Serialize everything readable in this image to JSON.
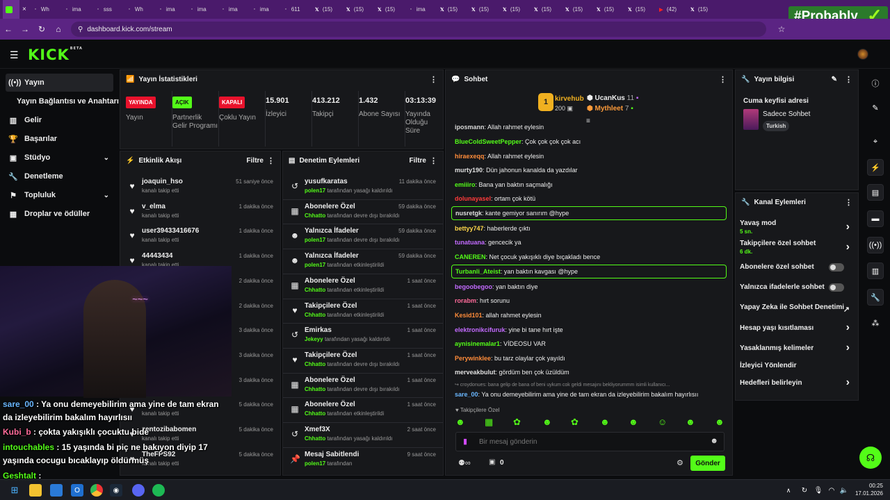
{
  "browser": {
    "tabs": [
      {
        "label": "",
        "icon": "kick-icon",
        "color": "#53fc18"
      },
      {
        "label": "Wh",
        "icon": "doc-icon",
        "color": "#bbb"
      },
      {
        "label": "ima",
        "icon": "doc-icon",
        "color": "#bbb"
      },
      {
        "label": "sss",
        "icon": "doc-icon",
        "color": "#bbb"
      },
      {
        "label": "Wh",
        "icon": "doc-icon",
        "color": "#bbb"
      },
      {
        "label": "ima",
        "icon": "doc-icon",
        "color": "#bbb"
      },
      {
        "label": "ima",
        "icon": "doc-icon",
        "color": "#bbb"
      },
      {
        "label": "ima",
        "icon": "doc-icon",
        "color": "#bbb"
      },
      {
        "label": "ima",
        "icon": "doc-icon",
        "color": "#bbb"
      },
      {
        "label": "611",
        "icon": "doc-icon",
        "color": "#bbb"
      },
      {
        "label": "(15)",
        "icon": "x-icon",
        "color": "#fff"
      },
      {
        "label": "(15)",
        "icon": "x-icon",
        "color": "#fff"
      },
      {
        "label": "(15)",
        "icon": "x-icon",
        "color": "#fff"
      },
      {
        "label": "ima",
        "icon": "doc-icon",
        "color": "#bbb"
      },
      {
        "label": "(15)",
        "icon": "x-icon",
        "color": "#fff"
      },
      {
        "label": "(15)",
        "icon": "x-icon",
        "color": "#fff"
      },
      {
        "label": "(15)",
        "icon": "x-icon",
        "color": "#fff"
      },
      {
        "label": "(15)",
        "icon": "x-icon",
        "color": "#fff"
      },
      {
        "label": "(15)",
        "icon": "x-icon",
        "color": "#fff"
      },
      {
        "label": "(15)",
        "icon": "x-icon",
        "color": "#fff"
      },
      {
        "label": "(15)",
        "icon": "x-icon",
        "color": "#fff"
      },
      {
        "label": "(42)",
        "icon": "youtube-icon",
        "color": "#ff2020"
      },
      {
        "label": "(15)",
        "icon": "x-icon",
        "color": "#fff"
      }
    ],
    "url": "dashboard.kick.com/stream",
    "overlay_tag": "#Probably"
  },
  "logo": "KICK",
  "logo_sup": "BETA",
  "sidebar": {
    "items": [
      {
        "label": "Yayın",
        "icon": "broadcast-icon"
      },
      {
        "label": "Yayın Bağlantısı ve Anahtarı",
        "icon": ""
      },
      {
        "label": "Gelir",
        "icon": "revenue-icon"
      },
      {
        "label": "Başarılar",
        "icon": "trophy-icon"
      },
      {
        "label": "Stüdyo",
        "icon": "studio-icon"
      },
      {
        "label": "Denetleme",
        "icon": "wrench-icon"
      },
      {
        "label": "Topluluk",
        "icon": "community-icon"
      },
      {
        "label": "Droplar ve ödüller",
        "icon": "gift-icon"
      }
    ]
  },
  "stats": {
    "title": "Yayın İstatistikleri",
    "items": [
      {
        "badge": "YAYINDA",
        "badge_color": "#e8122c",
        "label": "Yayın"
      },
      {
        "badge": "AÇIK",
        "badge_color": "#53fc18",
        "label": "Partnerlik Gelir Programı"
      },
      {
        "badge": "KAPALI",
        "badge_color": "#e8122c",
        "label": "Çoklu Yayın"
      },
      {
        "value": "15.901",
        "label": "İzleyici"
      },
      {
        "value": "413.212",
        "label": "Takipçi"
      },
      {
        "value": "1.432",
        "label": "Abone Sayısı"
      },
      {
        "value": "03:13:39",
        "label": "Yayında Olduğu Süre"
      }
    ]
  },
  "activity": {
    "title": "Etkinlik Akışı",
    "filter": "Filtre",
    "items": [
      {
        "name": "joaquin_hso",
        "sub": "kanalı takip etti",
        "time": "51 saniye önce"
      },
      {
        "name": "v_elma",
        "sub": "kanalı takip etti",
        "time": "1 dakika önce"
      },
      {
        "name": "user39433416676",
        "sub": "kanalı takip etti",
        "time": "1 dakika önce"
      },
      {
        "name": "44443434",
        "sub": "kanalı takip etti",
        "time": "1 dakika önce"
      },
      {
        "name": "",
        "sub": "",
        "time": "2 dakika önce"
      },
      {
        "name": "",
        "sub": "",
        "time": "2 dakika önce"
      },
      {
        "name": "",
        "sub": "",
        "time": "3 dakika önce"
      },
      {
        "name": "",
        "sub": "",
        "time": "3 dakika önce"
      },
      {
        "name": "",
        "sub": "",
        "time": "3 dakika önce"
      },
      {
        "name": "",
        "sub": "kanalı takip etti",
        "time": "5 dakika önce"
      },
      {
        "name": "zentozibabomen",
        "sub": "kanalı takip etti",
        "time": "5 dakika önce"
      },
      {
        "name": "TheFPS92",
        "sub": "kanalı takip etti",
        "time": "5 dakika önce"
      }
    ]
  },
  "moderation": {
    "title": "Denetim Eylemleri",
    "filter": "Filtre",
    "items": [
      {
        "icon": "undo-icon",
        "name": "yusufkaratas",
        "actor": "polen17",
        "sub": "tarafından yasağı kaldırıldı",
        "time": "11 dakika önce"
      },
      {
        "icon": "gift-icon",
        "name": "Abonelere Özel",
        "actor": "Chhatto",
        "sub": "tarafından devre dışı bırakıldı",
        "time": "59 dakika önce"
      },
      {
        "icon": "smile-icon",
        "name": "Yalnızca İfadeler",
        "actor": "polen17",
        "sub": "tarafından devre dışı bırakıldı",
        "time": "59 dakika önce"
      },
      {
        "icon": "smile-icon",
        "name": "Yalnızca İfadeler",
        "actor": "polen17",
        "sub": "tarafından etkinleştirildi",
        "time": "59 dakika önce"
      },
      {
        "icon": "gift-icon",
        "name": "Abonelere Özel",
        "actor": "Chhatto",
        "sub": "tarafından etkinleştirildi",
        "time": "1 saat önce"
      },
      {
        "icon": "heart-icon",
        "name": "Takipçilere Özel",
        "actor": "Chhatto",
        "sub": "tarafından etkinleştirildi",
        "time": "1 saat önce"
      },
      {
        "icon": "undo-icon",
        "name": "Emirkas",
        "actor": "Jekeyy",
        "sub": "tarafından yasağı kaldırıldı",
        "time": "1 saat önce"
      },
      {
        "icon": "heart-icon",
        "name": "Takipçilere Özel",
        "actor": "Chhatto",
        "sub": "tarafından devre dışı bırakıldı",
        "time": "1 saat önce"
      },
      {
        "icon": "gift-icon",
        "name": "Abonelere Özel",
        "actor": "Chhatto",
        "sub": "tarafından devre dışı bırakıldı",
        "time": "1 saat önce"
      },
      {
        "icon": "gift-icon",
        "name": "Abonelere Özel",
        "actor": "Chhatto",
        "sub": "tarafından etkinleştirildi",
        "time": "1 saat önce"
      },
      {
        "icon": "undo-icon",
        "name": "Xmef3X",
        "actor": "Chhatto",
        "sub": "tarafından yasağı kaldırıldı",
        "time": "2 saat önce"
      },
      {
        "icon": "pin-icon",
        "name": "Mesaj Sabitlendi",
        "actor": "polen17",
        "sub": "tarafından",
        "time": "9 saat önce"
      }
    ]
  },
  "chat": {
    "title": "Sohbet",
    "leaderboard": [
      {
        "rank": "1",
        "name": "kirvehub",
        "amount": "200"
      },
      {
        "name": "UcanKus",
        "amount": "11"
      },
      {
        "name": "Mythleet",
        "amount": "7"
      }
    ],
    "messages": [
      {
        "user": "iposmann",
        "color": "#d8d8d8",
        "text": "Allah rahmet eylesin"
      },
      {
        "user": "BlueColdSweetPepper",
        "color": "#53fc18",
        "text": "Çok çok çok çok acı"
      },
      {
        "user": "hiraexeqq",
        "color": "#ff8c3a",
        "text": "Allah rahmet eylesin"
      },
      {
        "user": "murty190",
        "color": "#e0e0e0",
        "text": "Dün jahonun kanalda da yazdılar"
      },
      {
        "user": "emiiiro",
        "color": "#53fc18",
        "text": "Bana yan baktın saçmalığı"
      },
      {
        "user": "dolunayasel",
        "color": "#ff3b3b",
        "text": "ortam çok kötü"
      },
      {
        "user": "nusretgk",
        "color": "#e0e0e0",
        "text": "kante gemiyor sanırım @hype"
      },
      {
        "user": "bettyy747",
        "color": "#ffd84a",
        "text": "haberlerde çıktı"
      },
      {
        "user": "tunatuana",
        "color": "#c36bff",
        "text": "gencecik ya"
      },
      {
        "user": "CANEREN",
        "color": "#53fc18",
        "text": "Net çocuk yakışıklı diye bıçakladı bence"
      },
      {
        "user": "Turbanli_Ateist",
        "color": "#53fc18",
        "text": "yan baktın kavgası @hype"
      },
      {
        "user": "begoobegoo",
        "color": "#c36bff",
        "text": "yan baktın diye"
      },
      {
        "user": "rorabm",
        "color": "#ff6b9a",
        "text": "hırt sorunu"
      },
      {
        "user": "Kesid101",
        "color": "#ff8c3a",
        "text": "allah rahmet eylesin"
      },
      {
        "user": "elektronikcifuruk",
        "color": "#c36bff",
        "text": "yine bi tane hırt işte"
      },
      {
        "user": "aynisinemalar1",
        "color": "#53fc18",
        "text": "VİDEOSU VAR"
      },
      {
        "user": "Perywinklee",
        "color": "#ff8c3a",
        "text": "bu tarz olaylar çok yayıldı"
      },
      {
        "user": "merveakbulut",
        "color": "#e0e0e0",
        "text": "gördüm ben çok üzüldüm"
      },
      {
        "user": "sare_00",
        "color": "#6ab7ff",
        "text": "Ya onu demeyebilirim ama yine de tam ekran da izleyebilirim bakalım hayırlısıı"
      }
    ],
    "reply_preview": "↪ croydonues: bana gelip de bana of beni uykum cok geldi mesajını bekliyorummm isimli kullanıcı...",
    "followers_only": "Takipçilere Özel",
    "input_placeholder": "Bir mesaj gönderin",
    "points": "0",
    "send": "Gönder"
  },
  "stream_info": {
    "title": "Yayın bilgisi",
    "stream_title": "Cuma keyfisi adresi",
    "category": "Sadece Sohbet",
    "tag": "Turkish"
  },
  "channel_actions": {
    "title": "Kanal Eylemleri",
    "items": [
      {
        "label": "Yavaş mod",
        "sub": "5 sn.",
        "type": "chevron"
      },
      {
        "label": "Takipçilere özel sohbet",
        "sub": "6 dk.",
        "type": "chevron"
      },
      {
        "label": "Abonelere özel sohbet",
        "type": "toggle",
        "on": false
      },
      {
        "label": "Yalnızca ifadelerle sohbet",
        "type": "toggle",
        "on": false
      },
      {
        "label": "Yapay Zeka ile Sohbet Denetimi",
        "type": "external"
      },
      {
        "label": "Hesap yaşı kısıtlaması",
        "type": "chevron"
      },
      {
        "label": "Yasaklanmış kelimeler",
        "type": "chevron"
      },
      {
        "label": "İzleyici Yönlendir",
        "type": "none"
      },
      {
        "label": "Hedefleri belirleyin",
        "type": "chevron"
      }
    ]
  },
  "overlay_chat": [
    {
      "user": "sare_00",
      "color": "#6ab7ff",
      "text": ": Ya onu demeyebilirim ama yine de tam ekran",
      "text2": "da izleyebilirim bakalım hayırlısıı"
    },
    {
      "user": "Kubi_b",
      "color": "#ff6b9a",
      "text": ": çokta yakışıklı çocuktu bide"
    },
    {
      "user": "intouchables",
      "color": "#53fc18",
      "text": ": 15 yaşında bi piç ne bakıyon diyip 17",
      "text2": "yaşında cocugu bıcaklayıp öldürmüş"
    },
    {
      "user": "Geshtalt",
      "color": "#53fc18",
      "text": ":"
    }
  ],
  "taskbar": {
    "time": "00:25",
    "date": "17.01.2026"
  }
}
